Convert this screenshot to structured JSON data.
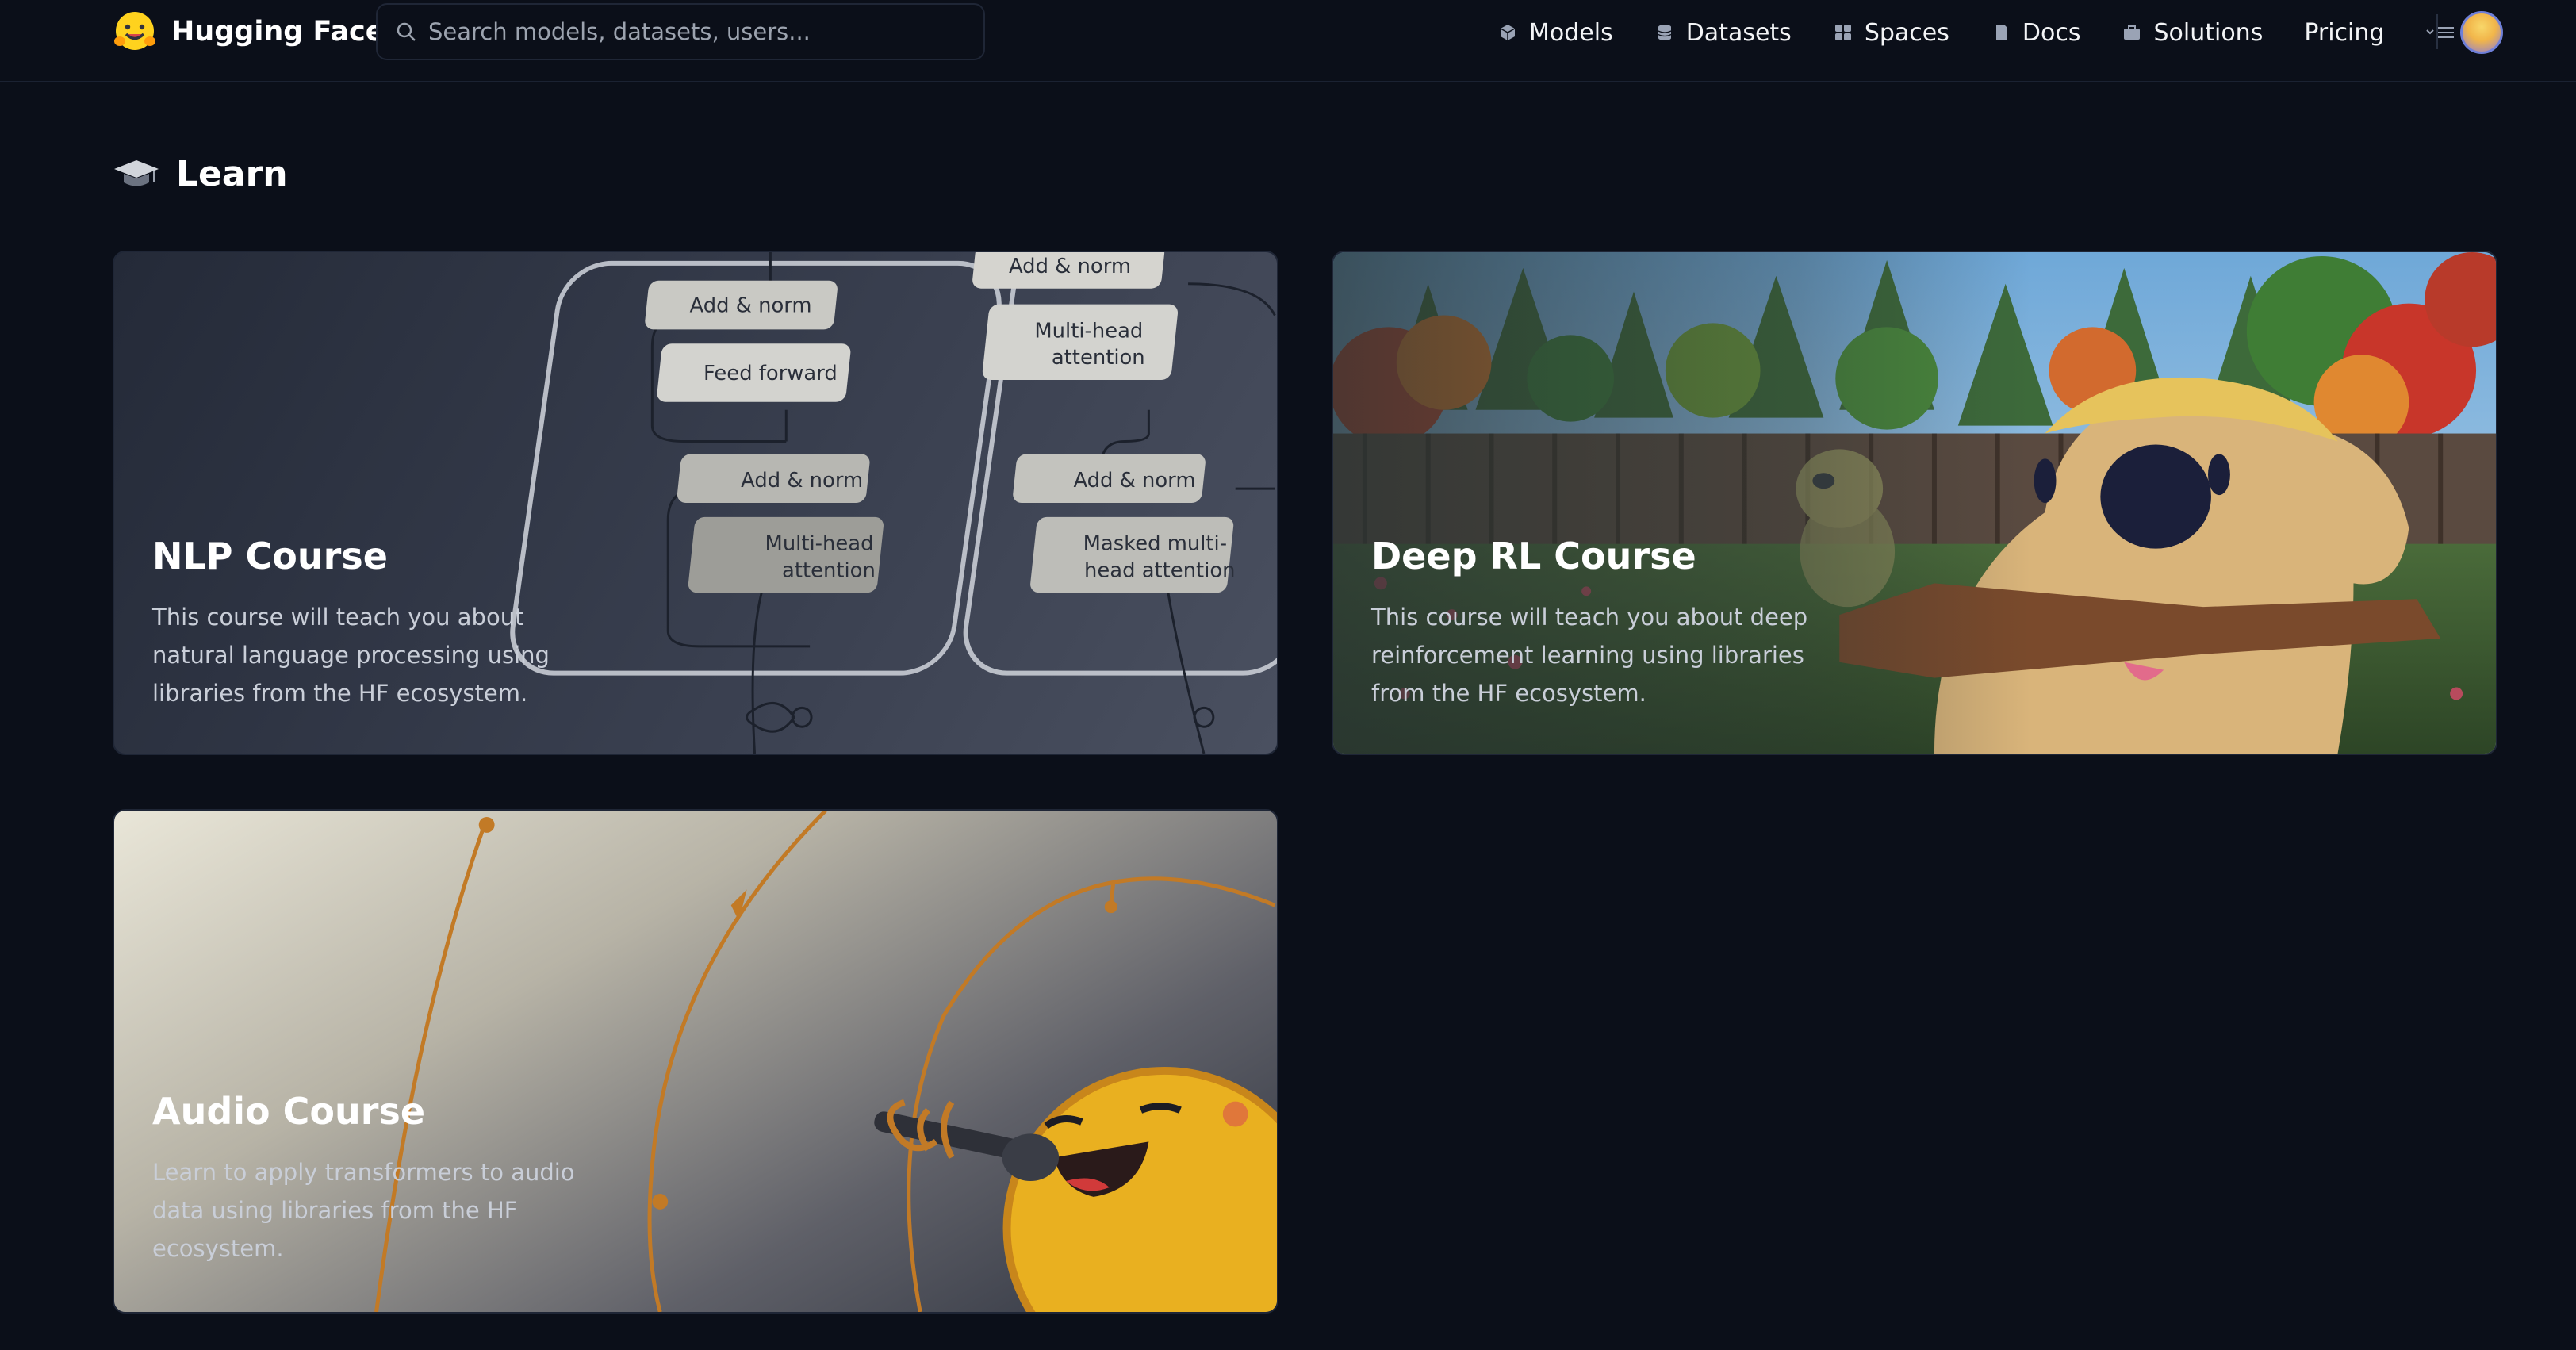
{
  "header": {
    "brand": "Hugging Face",
    "search_placeholder": "Search models, datasets, users...",
    "nav": [
      {
        "label": "Models",
        "icon": "cube-icon"
      },
      {
        "label": "Datasets",
        "icon": "database-icon"
      },
      {
        "label": "Spaces",
        "icon": "grid-icon"
      },
      {
        "label": "Docs",
        "icon": "doc-icon"
      },
      {
        "label": "Solutions",
        "icon": "briefcase-icon"
      },
      {
        "label": "Pricing",
        "icon": ""
      }
    ],
    "more_icon": "menu-icon",
    "avatar": "avatar"
  },
  "section": {
    "title": "Learn",
    "icon": "graduation-cap-icon"
  },
  "cards": {
    "nlp": {
      "title": "NLP Course",
      "description": "This course will teach you about natural language processing using libraries from the HF ecosystem.",
      "diagram": {
        "add_norm": "Add & norm",
        "feed_forward": "Feed forward",
        "multi_head_l1": "Multi-head",
        "multi_head_l2": "attention",
        "masked_l1": "Masked multi-",
        "masked_l2": "head attention"
      }
    },
    "rl": {
      "title": "Deep RL Course",
      "description": "This course will teach you about deep reinforcement learning using libraries from the HF ecosystem."
    },
    "audio": {
      "title": "Audio Course",
      "description": "Learn to apply transformers to audio data using libraries from the HF ecosystem."
    }
  },
  "colors": {
    "background": "#0b0f19",
    "accent": "#f1b54a"
  }
}
